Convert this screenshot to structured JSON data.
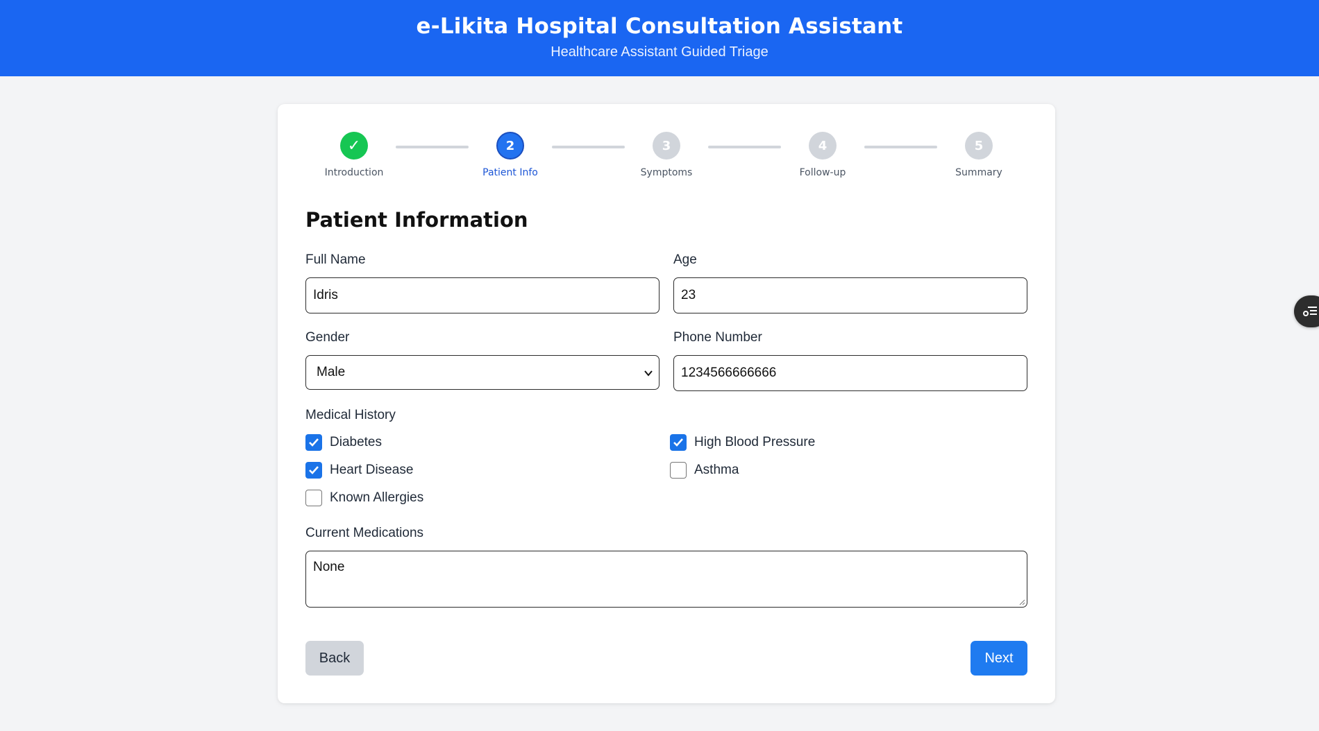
{
  "header": {
    "title": "e-Likita Hospital Consultation Assistant",
    "subtitle": "Healthcare Assistant Guided Triage"
  },
  "stepper": {
    "steps": [
      {
        "label": "Introduction",
        "number": "✓",
        "state": "done"
      },
      {
        "label": "Patient Info",
        "number": "2",
        "state": "active"
      },
      {
        "label": "Symptoms",
        "number": "3",
        "state": "todo"
      },
      {
        "label": "Follow-up",
        "number": "4",
        "state": "todo"
      },
      {
        "label": "Summary",
        "number": "5",
        "state": "todo"
      }
    ]
  },
  "form": {
    "title": "Patient Information",
    "full_name": {
      "label": "Full Name",
      "value": "Idris"
    },
    "age": {
      "label": "Age",
      "value": "23"
    },
    "gender": {
      "label": "Gender",
      "value": "Male"
    },
    "phone": {
      "label": "Phone Number",
      "value": "1234566666666"
    },
    "medical_history": {
      "label": "Medical History",
      "items": [
        {
          "label": "Diabetes",
          "checked": true
        },
        {
          "label": "High Blood Pressure",
          "checked": true
        },
        {
          "label": "Heart Disease",
          "checked": true
        },
        {
          "label": "Asthma",
          "checked": false
        },
        {
          "label": "Known Allergies",
          "checked": false
        }
      ]
    },
    "medications": {
      "label": "Current Medications",
      "value": "None"
    }
  },
  "buttons": {
    "back": "Back",
    "next": "Next"
  },
  "colors": {
    "header_bg": "#1a66f2",
    "done": "#16c653",
    "active": "#2373f0",
    "todo": "#d1d5db",
    "checkbox": "#1a73e8",
    "next_button": "#1f7bf0",
    "back_button": "#d1d5db"
  },
  "icons": {
    "checkmark": "check-icon",
    "dropdown": "chevron-down-icon",
    "side_widget": "list-settings-icon"
  }
}
